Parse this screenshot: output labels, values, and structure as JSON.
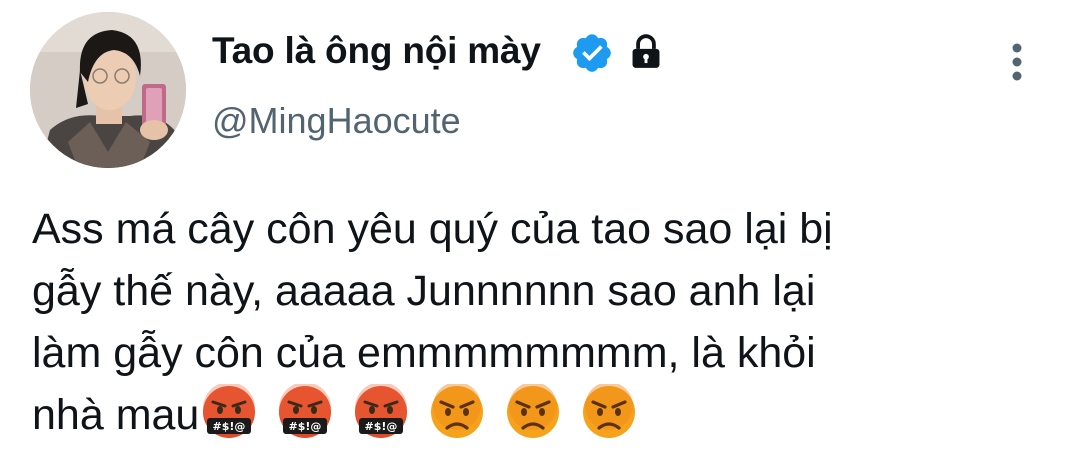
{
  "tweet": {
    "display_name": "Tao là ông nội mày",
    "handle": "@MingHaocute",
    "verified": true,
    "protected": true,
    "text_lines": [
      "Ass má cây côn yêu quý của tao sao lại bị",
      "gẫy thế này, aaaaa Junnnnnn sao anh lại",
      "làm gẫy côn của emmmmmmmm, là khỏi",
      "nhà mau"
    ],
    "emojis": [
      "face-with-symbols-on-mouth",
      "face-with-symbols-on-mouth",
      "face-with-symbols-on-mouth",
      "angry-face",
      "angry-face",
      "angry-face"
    ],
    "emoji_symbol_text": "#$!@"
  },
  "icons": {
    "avatar": "avatar-photo",
    "verified": "verified-badge-icon",
    "lock": "lock-icon",
    "more": "more-vertical-icon"
  },
  "colors": {
    "verified_blue": "#1d9bf0",
    "handle_gray": "#536471",
    "text": "#0f1419",
    "more_icon": "#536471"
  }
}
